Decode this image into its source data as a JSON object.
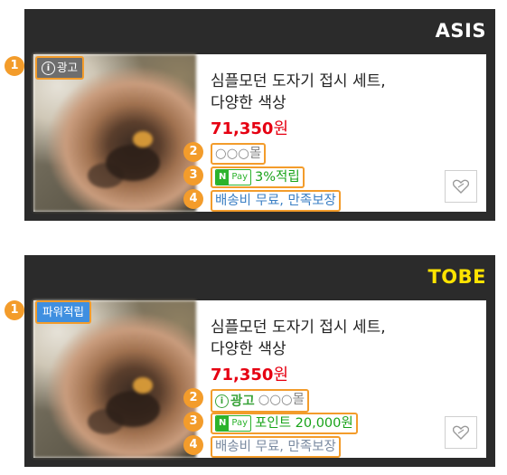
{
  "asis": {
    "tag": "ASIS",
    "ad_label": "광고",
    "title_line1": "심플모던 도자기 접시 세트,",
    "title_line2": "다양한 색상",
    "price_value": "71,350",
    "price_unit": "원",
    "mall": "○○○몰",
    "npay_n": "N",
    "npay_pay": "Pay",
    "npay_text": "3%적립",
    "shipping": "배송비 무료, 만족보장",
    "markers": [
      "1",
      "2",
      "3",
      "4"
    ]
  },
  "tobe": {
    "tag": "TOBE",
    "power_label": "파워적립",
    "title_line1": "심플모던 도자기 접시 세트,",
    "title_line2": "다양한 색상",
    "price_value": "71,350",
    "price_unit": "원",
    "ad_inline": "광고",
    "mall": "○○○몰",
    "npay_n": "N",
    "npay_pay": "Pay",
    "npay_text": "포인트 20,000원",
    "shipping": "배송비 무료, 만족보장",
    "markers": [
      "1",
      "2",
      "3",
      "4"
    ]
  },
  "icons": {
    "info": "i",
    "heart": "heart-icon"
  },
  "colors": {
    "panel_bg": "#2b2b2b",
    "highlight": "#f39c2b",
    "price": "#e60012",
    "npay_green": "#2cb32c",
    "shipping_blue": "#3b7fc4",
    "power_blue": "#3f8fe0",
    "tobe_tag": "#ffe400"
  }
}
